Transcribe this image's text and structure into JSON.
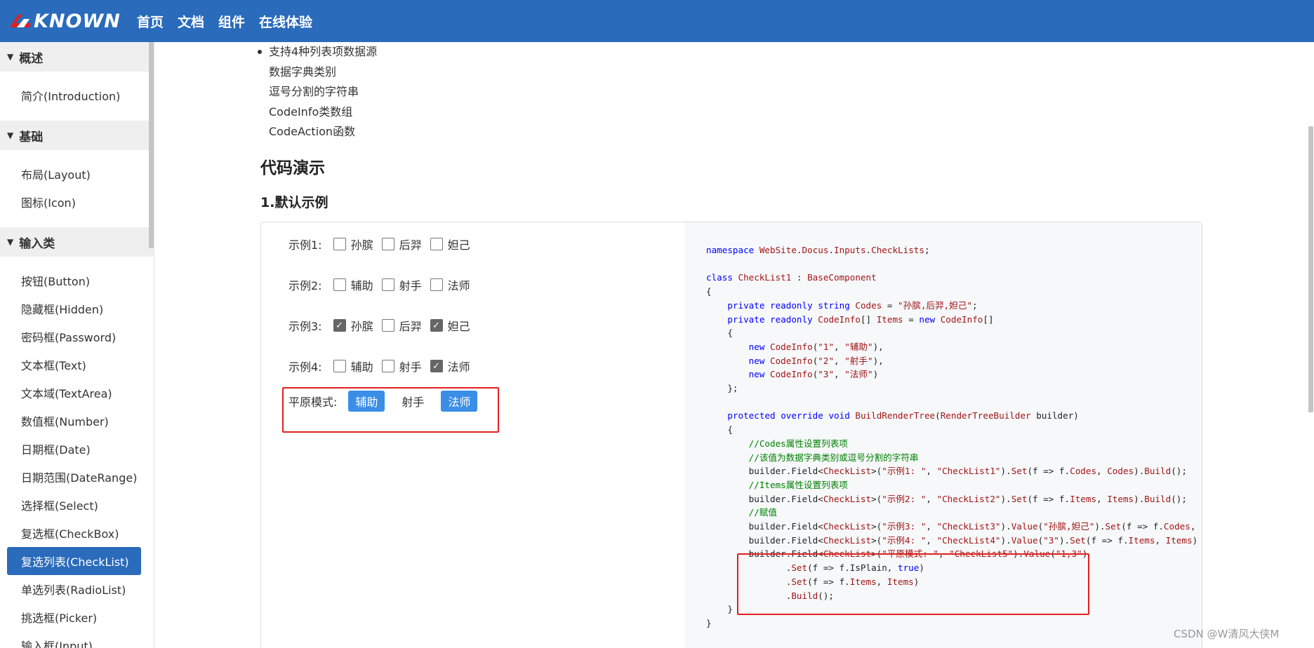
{
  "header": {
    "logo_text": "KNOWN",
    "nav": [
      "首页",
      "文档",
      "组件",
      "在线体验"
    ]
  },
  "sidebar": {
    "groups": [
      {
        "label": "概述",
        "items": [
          "简介(Introduction)"
        ]
      },
      {
        "label": "基础",
        "items": [
          "布局(Layout)",
          "图标(Icon)"
        ]
      },
      {
        "label": "输入类",
        "items": [
          "按钮(Button)",
          "隐藏框(Hidden)",
          "密码框(Password)",
          "文本框(Text)",
          "文本域(TextArea)",
          "数值框(Number)",
          "日期框(Date)",
          "日期范围(DateRange)",
          "选择框(Select)",
          "复选框(CheckBox)",
          "复选列表(CheckList)",
          "单选列表(RadioList)",
          "挑选框(Picker)",
          "输入框(Input)"
        ]
      }
    ],
    "active_item": "复选列表(CheckList)"
  },
  "main": {
    "bullet_title": "支持4种列表项数据源",
    "bullet_items": [
      "数据字典类别",
      "逗号分割的字符串",
      "CodeInfo类数组",
      "CodeAction函数"
    ],
    "section_title": "代码演示",
    "subsection_title": "1.默认示例"
  },
  "demo": {
    "rows": [
      {
        "label": "示例1:",
        "options": [
          {
            "text": "孙膑",
            "checked": false
          },
          {
            "text": "后羿",
            "checked": false
          },
          {
            "text": "妲己",
            "checked": false
          }
        ]
      },
      {
        "label": "示例2:",
        "options": [
          {
            "text": "辅助",
            "checked": false
          },
          {
            "text": "射手",
            "checked": false
          },
          {
            "text": "法师",
            "checked": false
          }
        ]
      },
      {
        "label": "示例3:",
        "options": [
          {
            "text": "孙膑",
            "checked": true
          },
          {
            "text": "后羿",
            "checked": false
          },
          {
            "text": "妲己",
            "checked": true
          }
        ]
      },
      {
        "label": "示例4:",
        "options": [
          {
            "text": "辅助",
            "checked": false
          },
          {
            "text": "射手",
            "checked": false
          },
          {
            "text": "法师",
            "checked": true
          }
        ]
      }
    ],
    "plain_label": "平原模式:",
    "plain_options": [
      {
        "text": "辅助",
        "on": true
      },
      {
        "text": "射手",
        "on": false
      },
      {
        "text": "法师",
        "on": true
      }
    ]
  },
  "code_lines": [
    "namespace WebSite.Docus.Inputs.CheckLists;",
    "",
    "class CheckList1 : BaseComponent",
    "{",
    "    private readonly string Codes = \"孙膑,后羿,妲己\";",
    "    private readonly CodeInfo[] Items = new CodeInfo[]",
    "    {",
    "        new CodeInfo(\"1\", \"辅助\"),",
    "        new CodeInfo(\"2\", \"射手\"),",
    "        new CodeInfo(\"3\", \"法师\")",
    "    };",
    "",
    "    protected override void BuildRenderTree(RenderTreeBuilder builder)",
    "    {",
    "        //Codes属性设置列表项",
    "        //该值为数据字典类别或逗号分割的字符串",
    "        builder.Field<CheckList>(\"示例1: \", \"CheckList1\").Set(f => f.Codes, Codes).Build();",
    "        //Items属性设置列表项",
    "        builder.Field<CheckList>(\"示例2: \", \"CheckList2\").Set(f => f.Items, Items).Build();",
    "        //赋值",
    "        builder.Field<CheckList>(\"示例3: \", \"CheckList3\").Value(\"孙膑,妲己\").Set(f => f.Codes,",
    "        builder.Field<CheckList>(\"示例4: \", \"CheckList4\").Value(\"3\").Set(f => f.Items, Items)",
    "        builder.Field<CheckList>(\"平原模式: \", \"CheckList5\").Value(\"1,3\")",
    "               .Set(f => f.IsPlain, true)",
    "               .Set(f => f.Items, Items)",
    "               .Build();",
    "    }",
    "}"
  ],
  "watermark": "CSDN @W清风大侠M"
}
